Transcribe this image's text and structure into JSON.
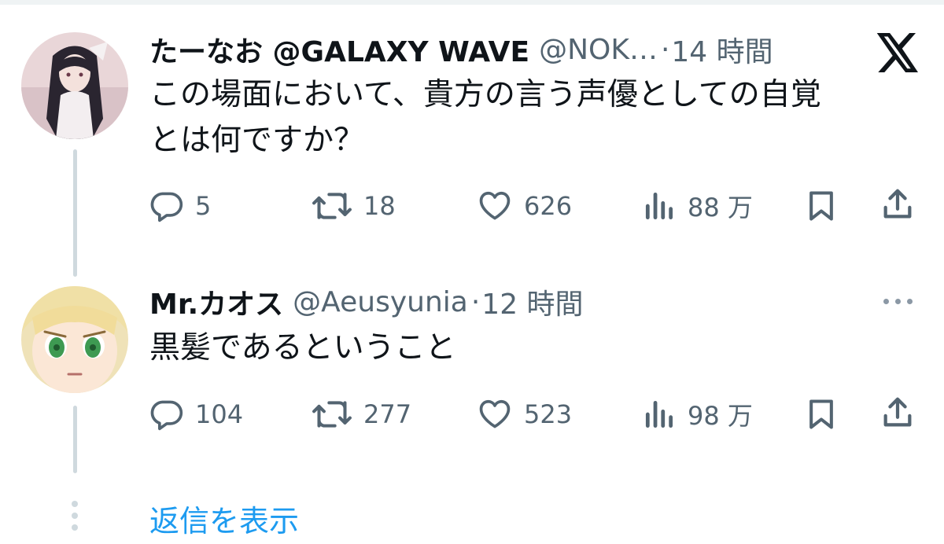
{
  "tweets": [
    {
      "display_name": "たーなお @GALAXY WAVE",
      "handle": "@NOK…",
      "separator": "·",
      "time": "14 時間",
      "text_lines": [
        "この場面において、貴方の言う声優としての自覚",
        "とは何ですか？"
      ],
      "replies": "5",
      "retweets": "18",
      "likes": "626",
      "views": "88 万"
    },
    {
      "display_name": "Mr.カオス",
      "handle": "@Aeusyunia",
      "separator": "·",
      "time": "12 時間",
      "text_lines": [
        "黒髪であるということ"
      ],
      "replies": "104",
      "retweets": "277",
      "likes": "523",
      "views": "98 万"
    }
  ],
  "show_replies_label": "返信を表示",
  "colors": {
    "text": "#0f1419",
    "secondary": "#536471",
    "link": "#1d9bf0",
    "thread_line": "#cfd9de"
  },
  "icons": [
    "x-logo",
    "reply-icon",
    "retweet-icon",
    "like-icon",
    "views-icon",
    "bookmark-icon",
    "share-icon",
    "more-icon"
  ]
}
